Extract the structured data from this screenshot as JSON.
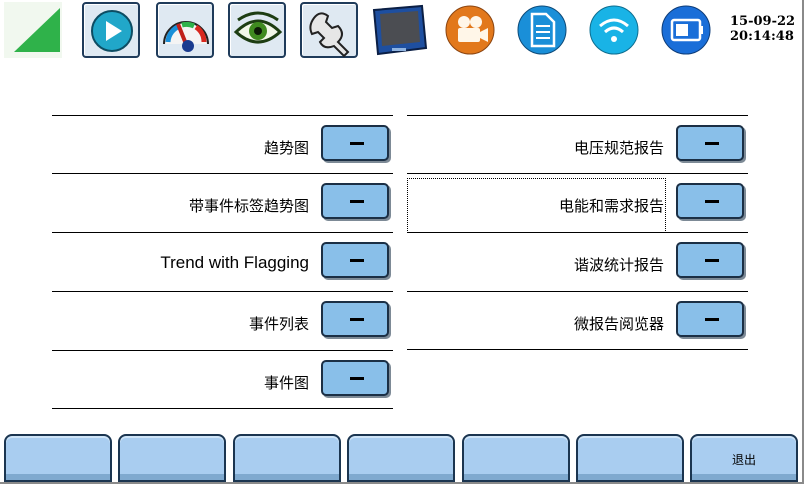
{
  "toolbar": {
    "buttons": [
      {
        "icon": "corner-triangle-icon"
      },
      {
        "icon": "play-screen-icon"
      },
      {
        "icon": "gauge-meter-icon"
      },
      {
        "icon": "eye-icon"
      },
      {
        "icon": "wrench-icon"
      },
      {
        "icon": "monitor-screen-icon"
      },
      {
        "icon": "video-camera-icon"
      },
      {
        "icon": "document-icon"
      },
      {
        "icon": "wifi-icon"
      },
      {
        "icon": "battery-screen-icon"
      }
    ],
    "date": "15-09-22",
    "time": "20:14:48"
  },
  "left_list": {
    "items": [
      {
        "label": "趋势图",
        "button": "-"
      },
      {
        "label": "带事件标签趋势图",
        "button": "-"
      },
      {
        "label": "Trend with Flagging",
        "button": "-"
      },
      {
        "label": "事件列表",
        "button": "-"
      },
      {
        "label": "事件图",
        "button": "-"
      }
    ]
  },
  "right_list": {
    "items": [
      {
        "label": "电压规范报告",
        "button": "-"
      },
      {
        "label": "电能和需求报告",
        "button": "-",
        "focused": true
      },
      {
        "label": "谐波统计报告",
        "button": "-"
      },
      {
        "label": "微报告阅览器",
        "button": "-"
      }
    ]
  },
  "function_keys": [
    {
      "label": ""
    },
    {
      "label": ""
    },
    {
      "label": ""
    },
    {
      "label": ""
    },
    {
      "label": ""
    },
    {
      "label": ""
    },
    {
      "label": "退出"
    }
  ],
  "colors": {
    "pill": "#89bfe9",
    "fkey": "#a9cdf0",
    "triangle": "#2fb24a",
    "orange": "#e2781b",
    "blue_round": "#1a8fd8"
  }
}
